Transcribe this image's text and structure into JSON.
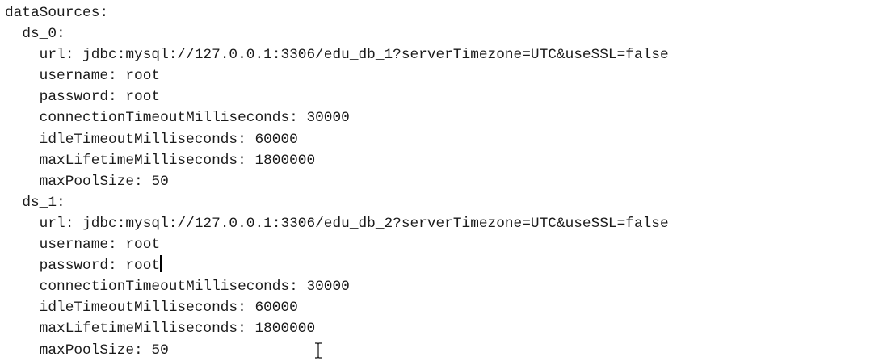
{
  "editor": {
    "lines": [
      "dataSources:",
      "  ds_0:",
      "    url: jdbc:mysql://127.0.0.1:3306/edu_db_1?serverTimezone=UTC&useSSL=false",
      "    username: root",
      "    password: root",
      "    connectionTimeoutMilliseconds: 30000",
      "    idleTimeoutMilliseconds: 60000",
      "    maxLifetimeMilliseconds: 1800000",
      "    maxPoolSize: 50",
      "  ds_1:",
      "    url: jdbc:mysql://127.0.0.1:3306/edu_db_2?serverTimezone=UTC&useSSL=false",
      "    username: root",
      "    password: root",
      "    connectionTimeoutMilliseconds: 30000",
      "    idleTimeoutMilliseconds: 60000",
      "    maxLifetimeMilliseconds: 1800000",
      "    maxPoolSize: 50"
    ],
    "caret_line": 12,
    "text_color": "#1a1a1a",
    "background": "#ffffff"
  },
  "cursor": {
    "type": "i-beam-cursor-icon"
  }
}
